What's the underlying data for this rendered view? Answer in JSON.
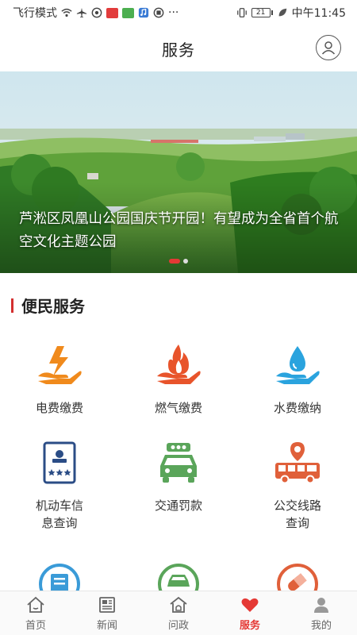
{
  "status_bar": {
    "mode_text": "飞行模式",
    "battery": "21",
    "time": "中午11:45"
  },
  "header": {
    "title": "服务"
  },
  "banner": {
    "caption": "芦淞区凤凰山公园国庆节开园！有望成为全省首个航空文化主题公园",
    "slide_count": 2,
    "active_slide": 1
  },
  "section": {
    "title": "便民服务"
  },
  "services": [
    {
      "label": "电费缴费",
      "icon": "lightning-hand-icon"
    },
    {
      "label": "燃气缴费",
      "icon": "flame-hand-icon"
    },
    {
      "label": "水费缴纳",
      "icon": "water-drop-hand-icon"
    },
    {
      "label": "机动车信\n息查询",
      "icon": "vehicle-license-icon"
    },
    {
      "label": "交通罚款",
      "icon": "car-fine-icon"
    },
    {
      "label": "公交线路\n查询",
      "icon": "bus-route-icon"
    },
    {
      "label": "",
      "icon": "document-circle-icon"
    },
    {
      "label": "",
      "icon": "car-circle-icon"
    },
    {
      "label": "",
      "icon": "pill-circle-icon"
    }
  ],
  "tabs": [
    {
      "label": "首页",
      "icon": "home-icon",
      "active": false
    },
    {
      "label": "新闻",
      "icon": "news-icon",
      "active": false
    },
    {
      "label": "问政",
      "icon": "government-icon",
      "active": false
    },
    {
      "label": "服务",
      "icon": "heart-icon",
      "active": true
    },
    {
      "label": "我的",
      "icon": "user-icon",
      "active": false
    }
  ],
  "colors": {
    "accent": "#e53935",
    "orange": "#f08a1c",
    "red_orange": "#e8542b",
    "blue": "#2aa3de",
    "navy": "#2b4d86",
    "green": "#5aa55a",
    "bus_orange": "#e0603a"
  }
}
